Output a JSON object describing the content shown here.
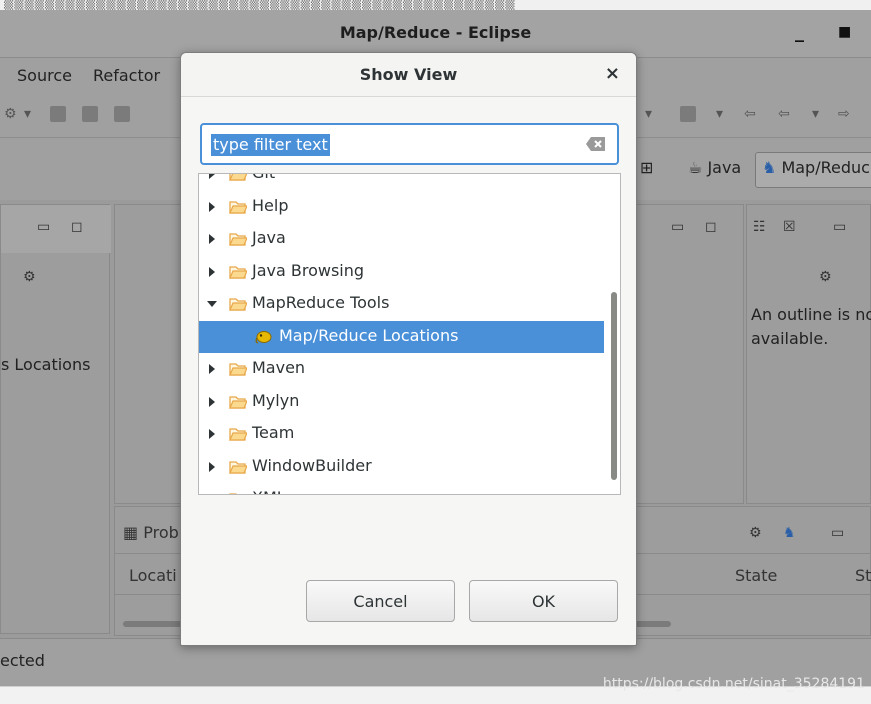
{
  "window": {
    "title": "Map/Reduce - Eclipse",
    "minimize": "_",
    "maximize": "▫"
  },
  "menu": {
    "items": [
      "Source",
      "Refactor"
    ]
  },
  "perspectives": {
    "java": "Java",
    "mapreduce": "Map/Reduc"
  },
  "left_panel": {
    "label": "s Locations"
  },
  "outline": {
    "text_line1": "An outline is no",
    "text_line2": "available."
  },
  "bottom_panel": {
    "tab": "Prob",
    "col_location": "Locati",
    "col_state": "State",
    "col_st": "St"
  },
  "status": {
    "text": "ected"
  },
  "watermark": "https://blog.csdn.net/sinat_35284191",
  "dialog": {
    "title": "Show View",
    "close": "×",
    "filter_placeholder": "type filter text",
    "filter_value": "type filter text",
    "tree": [
      {
        "label": "Git",
        "expanded": false,
        "partial": "top"
      },
      {
        "label": "Help",
        "expanded": false
      },
      {
        "label": "Java",
        "expanded": false
      },
      {
        "label": "Java Browsing",
        "expanded": false
      },
      {
        "label": "MapReduce Tools",
        "expanded": true
      },
      {
        "label": "Map/Reduce Locations",
        "child": true,
        "selected": true
      },
      {
        "label": "Maven",
        "expanded": false
      },
      {
        "label": "Mylyn",
        "expanded": false
      },
      {
        "label": "Team",
        "expanded": false
      },
      {
        "label": "WindowBuilder",
        "expanded": false
      },
      {
        "label": "XML",
        "expanded": false,
        "partial": "bottom"
      }
    ],
    "cancel_label": "Cancel",
    "ok_label": "OK"
  },
  "colors": {
    "accent": "#4a90d9",
    "folder": "#e8a84a",
    "mapreduce_icon": "#e6b800"
  },
  "icons": {
    "close": "close-icon",
    "clear": "clear-filter-icon",
    "folder": "folder-icon",
    "expand": "chevron-right-icon",
    "collapse": "chevron-down-icon",
    "mapreduce": "mapreduce-elephant-icon"
  }
}
